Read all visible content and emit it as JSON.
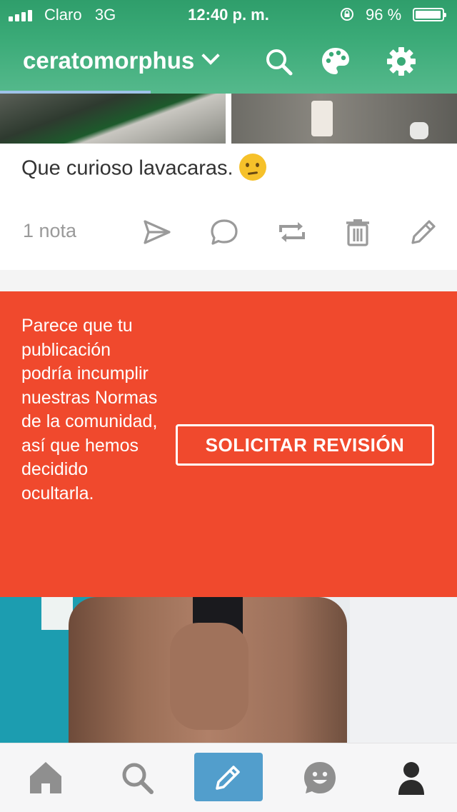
{
  "status_bar": {
    "carrier": "Claro",
    "network": "3G",
    "time": "12:40 p. m.",
    "battery": "96 %"
  },
  "header": {
    "blog_name": "ceratomorphus",
    "icons": [
      "chevron-down-icon",
      "search-icon",
      "palette-icon",
      "gear-icon"
    ],
    "progress_fraction": 0.33
  },
  "post": {
    "caption": "Que curioso lavacaras.",
    "caption_emoji": "thinking-face-icon",
    "notes": "1 nota",
    "action_icons": [
      "share-icon",
      "comment-icon",
      "reblog-icon",
      "delete-icon",
      "edit-icon"
    ]
  },
  "flagged": {
    "message": "Parece que tu publicación podría incumplir nuestras Normas de la comunidad, así que hemos decidido ocultarla.",
    "button": "SOLICITAR REVISIÓN"
  },
  "tab_bar": {
    "items": [
      "home-icon",
      "search-icon",
      "compose-icon",
      "activity-icon",
      "account-icon"
    ]
  },
  "colors": {
    "header_green": "#3aaa77",
    "flag_red": "#f0492d",
    "compose_blue": "#529ecc",
    "progress_blue": "#9fc3e9",
    "icon_gray": "#9a9a9a"
  }
}
